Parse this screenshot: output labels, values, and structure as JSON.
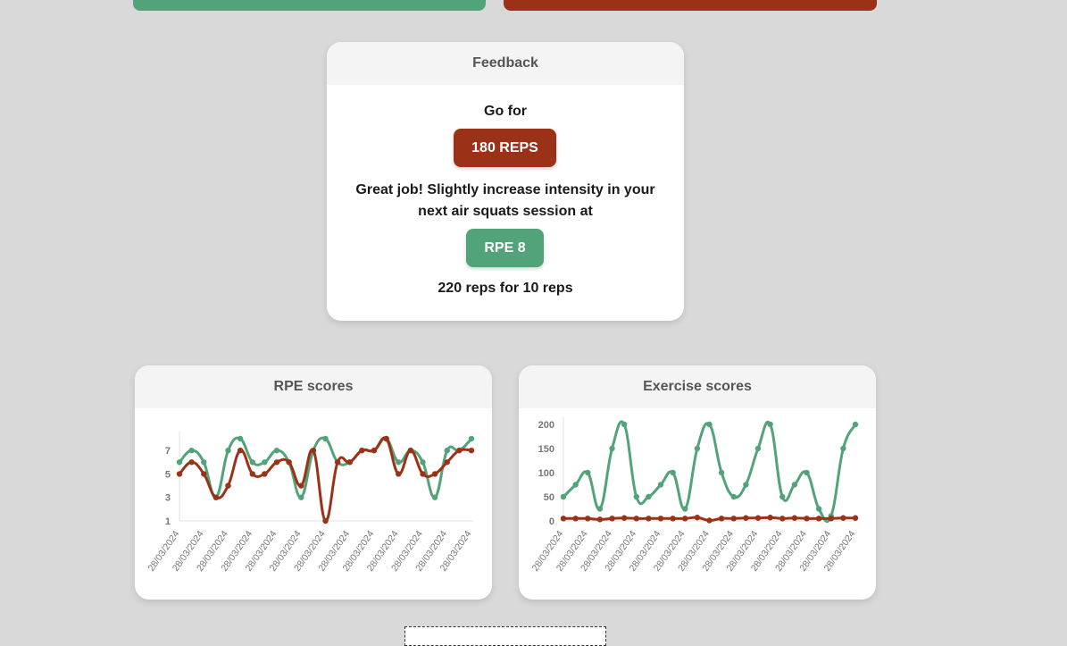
{
  "colors": {
    "green": "#52a37a",
    "red": "#9b3217",
    "background": "#d9d9d9"
  },
  "feedback": {
    "title": "Feedback",
    "go_for": "Go for",
    "reps_button": "180 REPS",
    "message_line1": "Great job! Slightly increase intensity in your",
    "message_line2": "next air squats session at",
    "rpe_button": "RPE 8",
    "footer": "220 reps for 10 reps"
  },
  "chart_data": [
    {
      "type": "line",
      "title": "RPE scores",
      "x": [
        "28/03/2024",
        "28/03/2024",
        "28/03/2024",
        "28/03/2024",
        "28/03/2024",
        "28/03/2024",
        "28/03/2024",
        "28/03/2024",
        "28/03/2024",
        "28/03/2024",
        "28/03/2024",
        "28/03/2024",
        "28/03/2024",
        "28/03/2024",
        "28/03/2024",
        "28/03/2024",
        "28/03/2024",
        "28/03/2024",
        "28/03/2024",
        "28/03/2024",
        "28/03/2024",
        "28/03/2024",
        "28/03/2024",
        "28/03/2024",
        "28/03/2024"
      ],
      "yticks": [
        1,
        3,
        5,
        7
      ],
      "ylim": [
        1,
        8
      ],
      "grid": false,
      "series": [
        {
          "color": "#52a37a",
          "values": [
            6,
            7,
            6,
            3,
            7,
            8,
            6,
            6,
            7,
            6,
            3,
            7,
            8,
            6,
            6,
            7,
            7,
            8,
            6,
            7,
            6,
            3,
            7,
            7,
            8
          ]
        },
        {
          "color": "#9b3217",
          "values": [
            5,
            6,
            5,
            3,
            4,
            7,
            5,
            5,
            6,
            6,
            4,
            7,
            1,
            6,
            6,
            7,
            7,
            8,
            5,
            7,
            5,
            5,
            6,
            7,
            7
          ]
        }
      ]
    },
    {
      "type": "line",
      "title": "Exercise scores",
      "x": [
        "28/03/2024",
        "28/03/2024",
        "28/03/2024",
        "28/03/2024",
        "28/03/2024",
        "28/03/2024",
        "28/03/2024",
        "28/03/2024",
        "28/03/2024",
        "28/03/2024",
        "28/03/2024",
        "28/03/2024",
        "28/03/2024",
        "28/03/2024",
        "28/03/2024",
        "28/03/2024",
        "28/03/2024",
        "28/03/2024",
        "28/03/2024",
        "28/03/2024",
        "28/03/2024",
        "28/03/2024",
        "28/03/2024",
        "28/03/2024",
        "28/03/2024"
      ],
      "yticks": [
        0,
        50,
        100,
        150,
        200
      ],
      "ylim": [
        0,
        200
      ],
      "grid": false,
      "series": [
        {
          "color": "#52a37a",
          "values": [
            50,
            75,
            100,
            25,
            150,
            200,
            50,
            50,
            75,
            100,
            25,
            150,
            200,
            100,
            50,
            75,
            150,
            200,
            50,
            75,
            100,
            25,
            10,
            150,
            200
          ]
        },
        {
          "color": "#9b3217",
          "values": [
            5,
            5,
            5,
            3,
            5,
            6,
            5,
            5,
            5,
            5,
            5,
            7,
            1,
            5,
            5,
            6,
            6,
            7,
            5,
            6,
            5,
            5,
            5,
            6,
            6
          ]
        }
      ]
    }
  ]
}
